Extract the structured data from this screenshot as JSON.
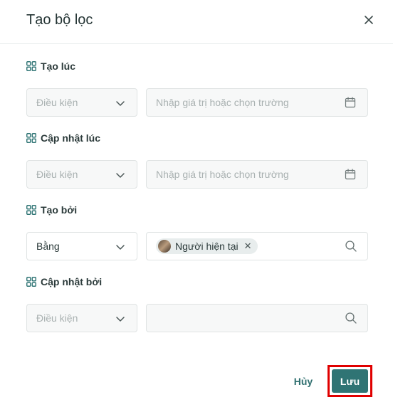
{
  "dialog": {
    "title": "Tạo bộ lọc",
    "close_icon": "close-icon"
  },
  "filters": [
    {
      "label": "Tạo lúc",
      "condition": {
        "placeholder": "Điều kiện",
        "value": ""
      },
      "value_field": {
        "placeholder": "Nhập giá trị hoặc chọn trường",
        "icon": "calendar-icon"
      }
    },
    {
      "label": "Cập nhật lúc",
      "condition": {
        "placeholder": "Điều kiện",
        "value": ""
      },
      "value_field": {
        "placeholder": "Nhập giá trị hoặc chọn trường",
        "icon": "calendar-icon"
      }
    },
    {
      "label": "Tạo bởi",
      "condition": {
        "placeholder": "",
        "value": "Bằng"
      },
      "value_field": {
        "chip": "Người hiện tại",
        "icon": "search-icon"
      }
    },
    {
      "label": "Cập nhật bởi",
      "condition": {
        "placeholder": "Điều kiện",
        "value": ""
      },
      "value_field": {
        "placeholder": "",
        "icon": "search-icon"
      }
    }
  ],
  "footer": {
    "cancel_label": "Hủy",
    "save_label": "Lưu"
  },
  "colors": {
    "accent": "#2f7474",
    "highlight": "#e00000"
  }
}
